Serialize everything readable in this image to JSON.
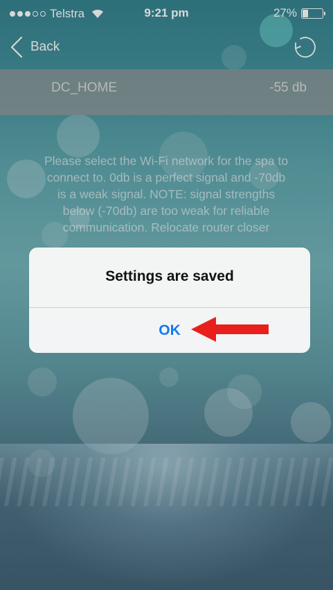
{
  "status_bar": {
    "carrier": "Telstra",
    "time": "9:21 pm",
    "battery": "27%",
    "battery_level": 0.27,
    "signal_bars_filled": 3,
    "signal_bars_total": 5
  },
  "nav": {
    "back_label": "Back"
  },
  "network": {
    "ssid": "DC_HOME",
    "signal": "-55 db"
  },
  "description": "Please select the Wi-Fi network for the spa to connect to. 0db is a perfect signal and -70db is a weak signal. NOTE: signal strengths below (-70db) are too weak for reliable communication. Relocate router closer",
  "alert": {
    "title": "Settings are saved",
    "ok_label": "OK"
  },
  "colors": {
    "accent": "#1479f0",
    "annotation_arrow": "#e8201c"
  }
}
